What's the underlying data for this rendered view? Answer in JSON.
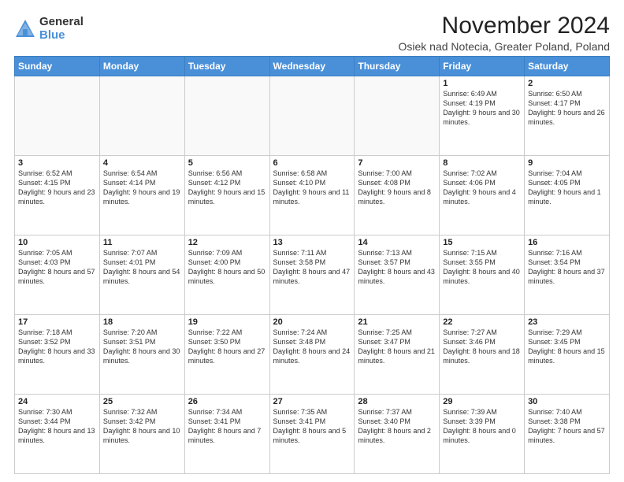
{
  "header": {
    "logo_general": "General",
    "logo_blue": "Blue",
    "month": "November 2024",
    "location": "Osiek nad Notecia, Greater Poland, Poland"
  },
  "calendar": {
    "days_of_week": [
      "Sunday",
      "Monday",
      "Tuesday",
      "Wednesday",
      "Thursday",
      "Friday",
      "Saturday"
    ],
    "weeks": [
      [
        {
          "day": "",
          "info": ""
        },
        {
          "day": "",
          "info": ""
        },
        {
          "day": "",
          "info": ""
        },
        {
          "day": "",
          "info": ""
        },
        {
          "day": "",
          "info": ""
        },
        {
          "day": "1",
          "info": "Sunrise: 6:49 AM\nSunset: 4:19 PM\nDaylight: 9 hours\nand 30 minutes."
        },
        {
          "day": "2",
          "info": "Sunrise: 6:50 AM\nSunset: 4:17 PM\nDaylight: 9 hours\nand 26 minutes."
        }
      ],
      [
        {
          "day": "3",
          "info": "Sunrise: 6:52 AM\nSunset: 4:15 PM\nDaylight: 9 hours\nand 23 minutes."
        },
        {
          "day": "4",
          "info": "Sunrise: 6:54 AM\nSunset: 4:14 PM\nDaylight: 9 hours\nand 19 minutes."
        },
        {
          "day": "5",
          "info": "Sunrise: 6:56 AM\nSunset: 4:12 PM\nDaylight: 9 hours\nand 15 minutes."
        },
        {
          "day": "6",
          "info": "Sunrise: 6:58 AM\nSunset: 4:10 PM\nDaylight: 9 hours\nand 11 minutes."
        },
        {
          "day": "7",
          "info": "Sunrise: 7:00 AM\nSunset: 4:08 PM\nDaylight: 9 hours\nand 8 minutes."
        },
        {
          "day": "8",
          "info": "Sunrise: 7:02 AM\nSunset: 4:06 PM\nDaylight: 9 hours\nand 4 minutes."
        },
        {
          "day": "9",
          "info": "Sunrise: 7:04 AM\nSunset: 4:05 PM\nDaylight: 9 hours\nand 1 minute."
        }
      ],
      [
        {
          "day": "10",
          "info": "Sunrise: 7:05 AM\nSunset: 4:03 PM\nDaylight: 8 hours\nand 57 minutes."
        },
        {
          "day": "11",
          "info": "Sunrise: 7:07 AM\nSunset: 4:01 PM\nDaylight: 8 hours\nand 54 minutes."
        },
        {
          "day": "12",
          "info": "Sunrise: 7:09 AM\nSunset: 4:00 PM\nDaylight: 8 hours\nand 50 minutes."
        },
        {
          "day": "13",
          "info": "Sunrise: 7:11 AM\nSunset: 3:58 PM\nDaylight: 8 hours\nand 47 minutes."
        },
        {
          "day": "14",
          "info": "Sunrise: 7:13 AM\nSunset: 3:57 PM\nDaylight: 8 hours\nand 43 minutes."
        },
        {
          "day": "15",
          "info": "Sunrise: 7:15 AM\nSunset: 3:55 PM\nDaylight: 8 hours\nand 40 minutes."
        },
        {
          "day": "16",
          "info": "Sunrise: 7:16 AM\nSunset: 3:54 PM\nDaylight: 8 hours\nand 37 minutes."
        }
      ],
      [
        {
          "day": "17",
          "info": "Sunrise: 7:18 AM\nSunset: 3:52 PM\nDaylight: 8 hours\nand 33 minutes."
        },
        {
          "day": "18",
          "info": "Sunrise: 7:20 AM\nSunset: 3:51 PM\nDaylight: 8 hours\nand 30 minutes."
        },
        {
          "day": "19",
          "info": "Sunrise: 7:22 AM\nSunset: 3:50 PM\nDaylight: 8 hours\nand 27 minutes."
        },
        {
          "day": "20",
          "info": "Sunrise: 7:24 AM\nSunset: 3:48 PM\nDaylight: 8 hours\nand 24 minutes."
        },
        {
          "day": "21",
          "info": "Sunrise: 7:25 AM\nSunset: 3:47 PM\nDaylight: 8 hours\nand 21 minutes."
        },
        {
          "day": "22",
          "info": "Sunrise: 7:27 AM\nSunset: 3:46 PM\nDaylight: 8 hours\nand 18 minutes."
        },
        {
          "day": "23",
          "info": "Sunrise: 7:29 AM\nSunset: 3:45 PM\nDaylight: 8 hours\nand 15 minutes."
        }
      ],
      [
        {
          "day": "24",
          "info": "Sunrise: 7:30 AM\nSunset: 3:44 PM\nDaylight: 8 hours\nand 13 minutes."
        },
        {
          "day": "25",
          "info": "Sunrise: 7:32 AM\nSunset: 3:42 PM\nDaylight: 8 hours\nand 10 minutes."
        },
        {
          "day": "26",
          "info": "Sunrise: 7:34 AM\nSunset: 3:41 PM\nDaylight: 8 hours\nand 7 minutes."
        },
        {
          "day": "27",
          "info": "Sunrise: 7:35 AM\nSunset: 3:41 PM\nDaylight: 8 hours\nand 5 minutes."
        },
        {
          "day": "28",
          "info": "Sunrise: 7:37 AM\nSunset: 3:40 PM\nDaylight: 8 hours\nand 2 minutes."
        },
        {
          "day": "29",
          "info": "Sunrise: 7:39 AM\nSunset: 3:39 PM\nDaylight: 8 hours\nand 0 minutes."
        },
        {
          "day": "30",
          "info": "Sunrise: 7:40 AM\nSunset: 3:38 PM\nDaylight: 7 hours\nand 57 minutes."
        }
      ]
    ]
  }
}
